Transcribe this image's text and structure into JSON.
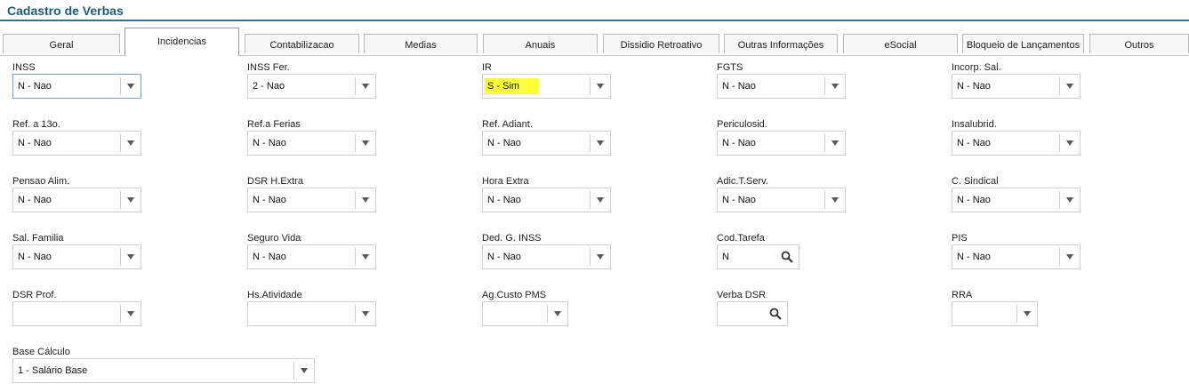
{
  "page": {
    "title": "Cadastro de Verbas"
  },
  "tabs": [
    "Geral",
    "Incidencias",
    "Contabilizacao",
    "Medias",
    "Anuais",
    "Dissidio Retroativo",
    "Outras Informações",
    "eSocial",
    "Bloqueio de Lançamentos",
    "Outros"
  ],
  "active_tab": "Incidencias",
  "fields": {
    "inss": {
      "label": "INSS",
      "value": "N - Nao"
    },
    "inss_fer": {
      "label": "INSS Fer.",
      "value": "2 - Nao"
    },
    "ir": {
      "label": "IR",
      "value": "S - Sim"
    },
    "fgts": {
      "label": "FGTS",
      "value": "N - Nao"
    },
    "incorp_sal": {
      "label": "Incorp. Sal.",
      "value": "N - Nao"
    },
    "ref_13o": {
      "label": "Ref. a 13o.",
      "value": "N - Nao"
    },
    "ref_ferias": {
      "label": "Ref.a Ferias",
      "value": "N - Nao"
    },
    "ref_adiant": {
      "label": "Ref. Adiant.",
      "value": "N - Nao"
    },
    "periculosid": {
      "label": "Periculosid.",
      "value": "N - Nao"
    },
    "insalubrid": {
      "label": "Insalubrid.",
      "value": "N - Nao"
    },
    "pensao_alim": {
      "label": "Pensao Alim.",
      "value": "N - Nao"
    },
    "dsr_hextra": {
      "label": "DSR H.Extra",
      "value": "N - Nao"
    },
    "hora_extra": {
      "label": "Hora Extra",
      "value": "N - Nao"
    },
    "adic_tserv": {
      "label": "Adic.T.Serv.",
      "value": "N - Nao"
    },
    "c_sindical": {
      "label": "C. Sindical",
      "value": "N - Nao"
    },
    "sal_familia": {
      "label": "Sal. Familia",
      "value": "N - Nao"
    },
    "seguro_vida": {
      "label": "Seguro Vida",
      "value": "N - Nao"
    },
    "ded_g_inss": {
      "label": "Ded. G. INSS",
      "value": "N - Nao"
    },
    "cod_tarefa": {
      "label": "Cod.Tarefa",
      "value": "N"
    },
    "pis": {
      "label": "PIS",
      "value": "N - Nao"
    },
    "dsr_prof": {
      "label": "DSR Prof.",
      "value": ""
    },
    "hs_atividade": {
      "label": "Hs.Atividade",
      "value": ""
    },
    "ag_custo_pms": {
      "label": "Ag.Custo PMS",
      "value": ""
    },
    "verba_dsr": {
      "label": "Verba DSR",
      "value": ""
    },
    "rra": {
      "label": "RRA",
      "value": ""
    },
    "base_calculo": {
      "label": "Base Cálculo",
      "value": "1 - Salário Base"
    }
  },
  "colors": {
    "title": "#1d5d74",
    "highlight": "#ffff3a",
    "focus_border": "#7aa7c7"
  },
  "icons": {
    "dropdown": "chevron-down-icon",
    "lookup": "search-icon"
  }
}
